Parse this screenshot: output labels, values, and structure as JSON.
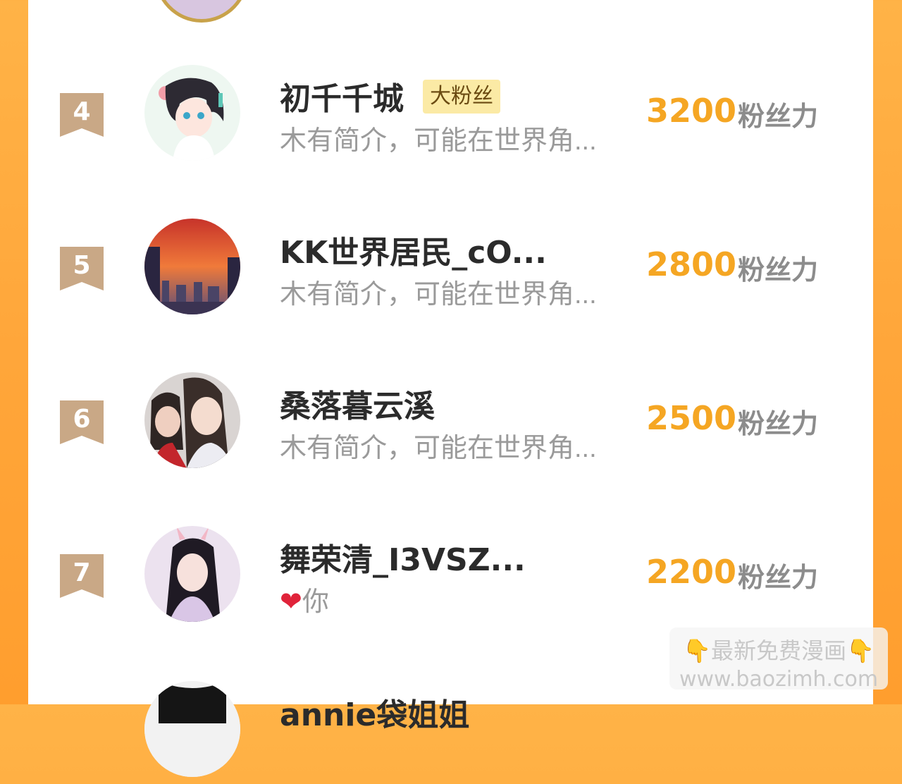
{
  "unit_label": "粉丝力",
  "rows": [
    {
      "rank": "4",
      "name": "初千千城",
      "badge": "大粉丝",
      "intro": "木有简介，可能在世界角...",
      "score": "3200"
    },
    {
      "rank": "5",
      "name": "KK世界居民_cO...",
      "badge": "",
      "intro": "木有简介，可能在世界角...",
      "score": "2800"
    },
    {
      "rank": "6",
      "name": "桑落暮云溪",
      "badge": "",
      "intro": "木有简介，可能在世界角...",
      "score": "2500"
    },
    {
      "rank": "7",
      "name": "舞荣清_I3VSZ...",
      "badge": "",
      "intro": "你",
      "score": "2200"
    }
  ],
  "next_row": {
    "name": "annie袋姐姐"
  },
  "watermark": {
    "line1": "最新免费漫画",
    "line2": "www.baozimh.com"
  },
  "colors": {
    "score": "#f5a623",
    "rank_bg": "#c9a886",
    "background": "#ffa63a"
  }
}
